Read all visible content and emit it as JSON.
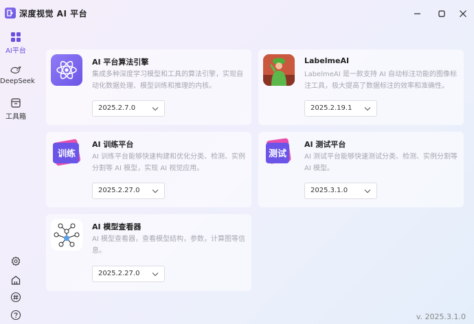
{
  "window": {
    "title": "深度视觉 AI 平台",
    "icons": [
      "app-logo-icon",
      "minimize-icon",
      "maximize-icon",
      "close-icon"
    ]
  },
  "sidebar": {
    "items": [
      {
        "label": "AI平台",
        "icon": "grid-icon",
        "active": true
      },
      {
        "label": "DeepSeek",
        "icon": "whale-icon",
        "active": false
      },
      {
        "label": "工具箱",
        "icon": "toolbox-icon",
        "active": false
      }
    ],
    "bottom_icons": [
      "settings-icon",
      "home-icon",
      "hash-icon",
      "help-icon"
    ]
  },
  "cards": [
    {
      "title": "AI 平台算法引擎",
      "description": "集成多种深度学习模型和工具的算法引擎，实现自动化数据处理、模型训练和推理的内核。",
      "version": "2025.2.7.0",
      "icon": "atom-icon"
    },
    {
      "title": "LabelmeAI",
      "description": "LabelmeAI 是一款支持 AI 自动标注功能的图像标注工具，极大提高了数据标注的效率和准确性。",
      "version": "2025.2.19.1",
      "icon": "labelme-image"
    },
    {
      "title": "AI 训练平台",
      "description": "AI 训练平台能够快速构建和优化分类、检测、实例分割等 AI 模型，实现 AI 视觉应用。",
      "version": "2025.2.27.0",
      "icon": "train-badge-icon",
      "icon_text": "训练"
    },
    {
      "title": "AI 测试平台",
      "description": "AI 测试平台能够快速测试分类、检测、实例分割等 AI 模型。",
      "version": "2025.3.1.0",
      "icon": "test-badge-icon",
      "icon_text": "测试"
    },
    {
      "title": "AI 模型查看器",
      "description": "AI 模型查看器，查看模型结构，参数，计算图等信息。",
      "version": "2025.2.27.0",
      "icon": "network-graph-icon"
    }
  ],
  "footer": {
    "version": "v. 2025.3.1.0"
  },
  "colors": {
    "accent": "#6a4fe0",
    "muted_text": "#a6a6b0"
  }
}
